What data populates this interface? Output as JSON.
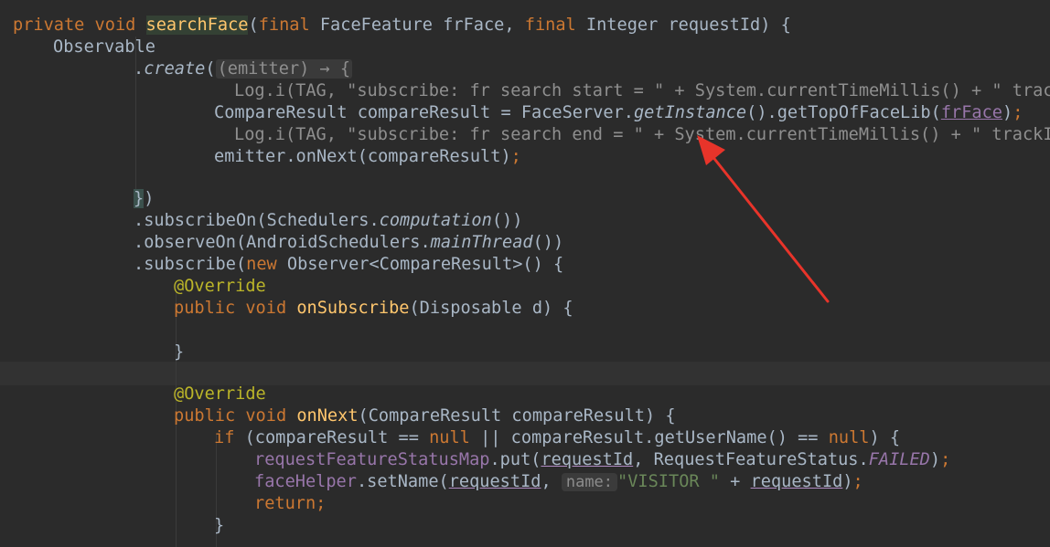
{
  "code": {
    "l1": {
      "kw1": "private void ",
      "fn": "searchFace",
      "p1": "(",
      "kw2": "final ",
      "p2": "FaceFeature frFace, ",
      "kw3": "final ",
      "p3": "Integer requestId) {"
    },
    "l2": {
      "t": "Observable"
    },
    "l3": {
      "dot": ".",
      "m": "create",
      "p1": "(",
      "fold": "(emitter) → {"
    },
    "l4": {
      "t1": "Log.i(TAG, ",
      "s": "\"subscribe: fr search start = \"",
      "t2": " + System.currentTimeMillis() + ",
      "s2": "\" track"
    },
    "l5": {
      "t1": "CompareResult compareResult = FaceServer.",
      "m": "getInstance",
      "t2": "().getTopOfFaceLib(",
      "arg": "frFace",
      "t3": ")",
      "semi": ";"
    },
    "l6": {
      "t1": "Log.i(TAG, ",
      "s": "\"subscribe: fr search end = \"",
      "t2": " + System.currentTimeMillis() + ",
      "s2": "\" trackId"
    },
    "l7": {
      "t1": "emitter.onNext(compareResult)",
      "semi": ";"
    },
    "l8": {
      "brace": "}",
      "t": ")"
    },
    "l9": {
      "t1": ".subscribeOn(Schedulers.",
      "m": "computation",
      "t2": "())"
    },
    "l10": {
      "t1": ".observeOn(AndroidSchedulers.",
      "m": "mainThread",
      "t2": "())"
    },
    "l11": {
      "t1": ".subscribe(",
      "kw": "new ",
      "t2": "Observer<CompareResult>() {"
    },
    "l12": {
      "ann": "@Override"
    },
    "l13": {
      "kw": "public void ",
      "fn": "onSubscribe",
      "t": "(Disposable d) {"
    },
    "l14": {
      "t": "}"
    },
    "l15": {
      "ann": "@Override"
    },
    "l16": {
      "kw": "public void ",
      "fn": "onNext",
      "t": "(CompareResult compareResult) {"
    },
    "l17": {
      "kw1": "if ",
      "t1": "(compareResult == ",
      "kw2": "null",
      "t2": " || compareResult.getUserName() == ",
      "kw3": "null",
      "t3": ") {"
    },
    "l18": {
      "fld": "requestFeatureStatusMap",
      "t1": ".put(",
      "arg": "requestId",
      "t2": ", RequestFeatureStatus.",
      "const": "FAILED",
      "t3": ")",
      "semi": ";"
    },
    "l19": {
      "fld": "faceHelper",
      "t1": ".setName(",
      "arg": "requestId",
      "t2": ", ",
      "hint": "name:",
      "s": "\"VISITOR \"",
      "t3": " + ",
      "arg2": "requestId",
      "t4": ")",
      "semi": ";"
    },
    "l20": {
      "kw": "return",
      "semi": ";"
    },
    "l21": {
      "t": "}"
    }
  },
  "colors": {
    "background": "#2b2b2b",
    "keyword": "#cc7832",
    "method": "#ffc66d",
    "string": "#6a8759",
    "annotation": "#bbb529",
    "field": "#9876aa",
    "arrow": "#e8342a"
  }
}
